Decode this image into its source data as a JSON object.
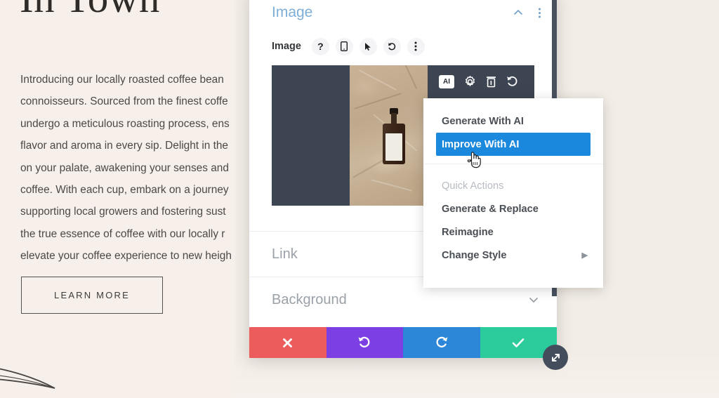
{
  "site": {
    "heading": "In Town",
    "paragraph_lines": [
      "Introducing our locally roasted coffee bean",
      "connoisseurs. Sourced from the finest coffe",
      "undergo a meticulous roasting process, ens",
      "flavor and aroma in every sip. Delight in the",
      "on your palate, awakening your senses and",
      "coffee. With each cup, embark on a journey",
      "supporting local growers and fostering sust",
      "the true essence of coffee with our locally r",
      "elevate your coffee experience to new heigh"
    ],
    "learn_more_label": "LEARN MORE",
    "decor_icon": "leaf-flourish-icon"
  },
  "modal": {
    "title": "Image",
    "collapse_icon": "chevron-up-icon",
    "more_icon": "vertical-dots-icon",
    "toolbar": {
      "label": "Image",
      "icons": [
        {
          "name": "help-icon",
          "glyph": "?"
        },
        {
          "name": "responsive-mobile-icon",
          "glyph": "mobile"
        },
        {
          "name": "hover-cursor-icon",
          "glyph": "cursor"
        },
        {
          "name": "reset-undo-icon",
          "glyph": "undo"
        },
        {
          "name": "more-options-icon",
          "glyph": "dots"
        }
      ]
    },
    "image_actions": [
      {
        "name": "ai-badge-button",
        "label": "AI"
      },
      {
        "name": "settings-gear-icon",
        "label": ""
      },
      {
        "name": "delete-trash-icon",
        "label": ""
      },
      {
        "name": "revert-undo-icon",
        "label": ""
      }
    ],
    "sections": [
      {
        "name": "link-section",
        "label": "Link",
        "chevron": ""
      },
      {
        "name": "background-section",
        "label": "Background",
        "chevron": "chevron-down-icon"
      }
    ],
    "action_buttons": [
      {
        "name": "cancel-button",
        "icon": "close-x-icon",
        "color": "#ed5c5c"
      },
      {
        "name": "undo-button",
        "icon": "undo-arrow-icon",
        "color": "#7b3fe4"
      },
      {
        "name": "redo-button",
        "icon": "redo-arrow-icon",
        "color": "#2d87d8"
      },
      {
        "name": "save-button",
        "icon": "checkmark-icon",
        "color": "#2bcb9c"
      }
    ],
    "resize_handle_icon": "diagonal-resize-icon"
  },
  "ai_menu": {
    "items": [
      {
        "name": "menu-item-generate-with-ai",
        "label": "Generate With AI",
        "state": "normal"
      },
      {
        "name": "menu-item-improve-with-ai",
        "label": "Improve With AI",
        "state": "active"
      }
    ],
    "quick_actions_heading": "Quick Actions",
    "quick_actions": [
      {
        "name": "menu-item-generate-and-replace",
        "label": "Generate & Replace",
        "submenu": false
      },
      {
        "name": "menu-item-reimagine",
        "label": "Reimagine",
        "submenu": false
      },
      {
        "name": "menu-item-change-style",
        "label": "Change Style",
        "submenu": true
      }
    ],
    "submenu_arrow_glyph": "▶",
    "cursor_icon": "pointing-hand-cursor"
  },
  "colors": {
    "accent_blue": "#1a89dd",
    "title_blue": "#7eaed8",
    "cancel_red": "#ed5c5c",
    "undo_purple": "#7b3fe4",
    "redo_blue": "#2d87d8",
    "save_green": "#2bcb9c",
    "preview_dark": "#3d4552",
    "page_cream": "#f7f0ea"
  }
}
